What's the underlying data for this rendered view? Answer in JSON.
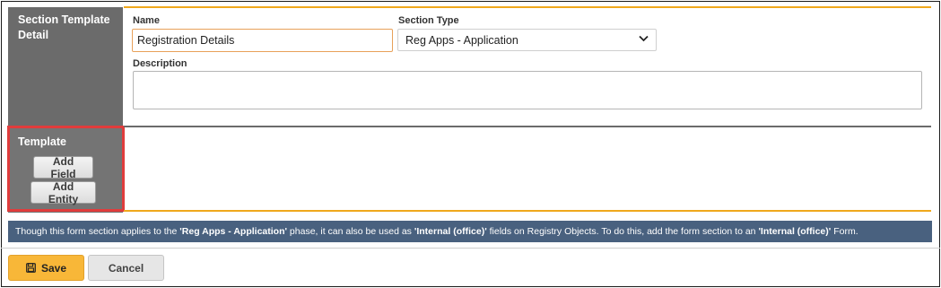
{
  "sidebar": {
    "detail_title": "Section Template Detail",
    "template_title": "Template",
    "add_field_label": "Add Field",
    "add_entity_label": "Add Entity"
  },
  "form": {
    "name_label": "Name",
    "name_value": "Registration Details",
    "section_type_label": "Section Type",
    "section_type_value": "Reg Apps - Application",
    "description_label": "Description",
    "description_value": ""
  },
  "info": {
    "part1": "Though this form section applies to the ",
    "phase": "'Reg Apps - Application'",
    "part2": " phase, it can also be used as ",
    "internal1": "'Internal (office)'",
    "part3": " fields on Registry Objects. To do this, add the form section to an ",
    "internal2": "'Internal (office)'",
    "part4": " Form."
  },
  "footer": {
    "save_label": "Save",
    "cancel_label": "Cancel"
  },
  "colors": {
    "accent_orange": "#f0a81c",
    "save_yellow": "#f8b738",
    "info_blue": "#49617f",
    "sidebar_gray": "#6b6b6b",
    "highlight_red": "#e03c3c"
  },
  "icons": {
    "save": "save-icon",
    "dropdown": "chevron-down-icon"
  }
}
